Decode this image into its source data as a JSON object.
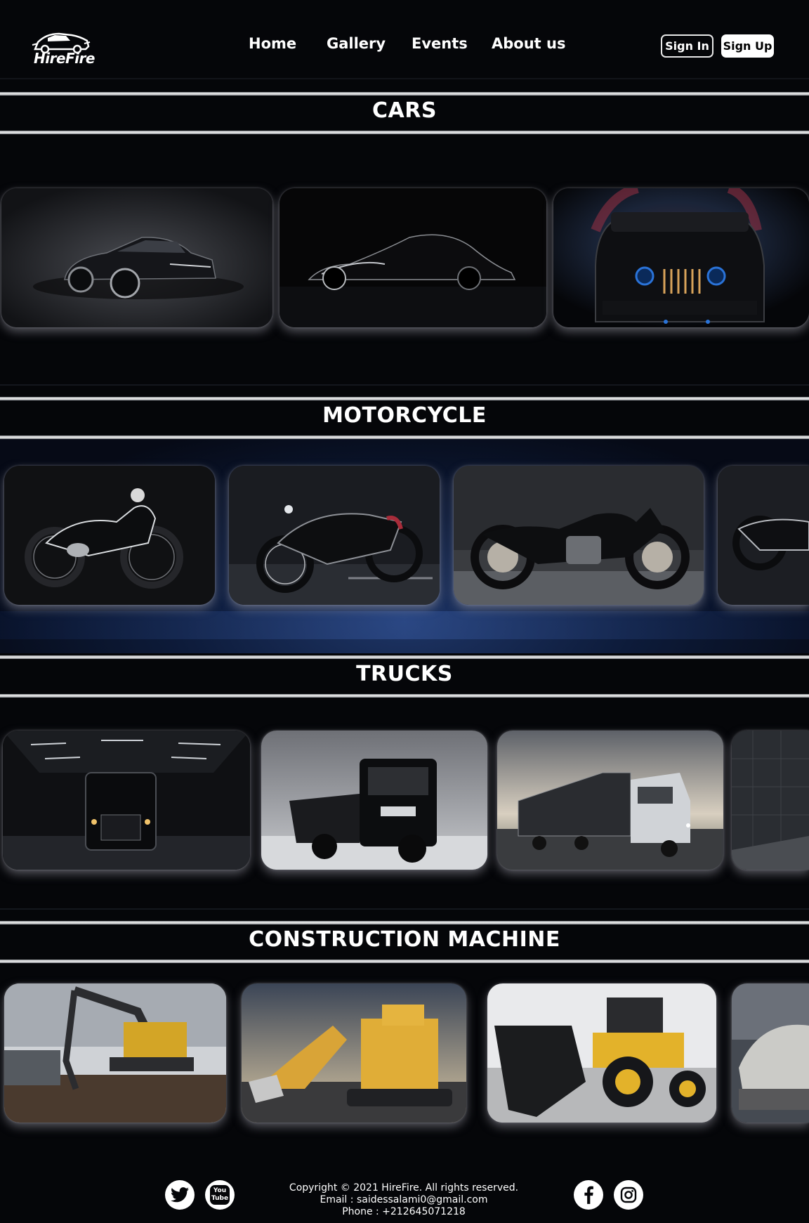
{
  "header": {
    "logo_text": "HireFire",
    "nav": [
      "Home",
      "Gallery",
      "Events",
      "About us"
    ],
    "sign_in": "Sign In",
    "sign_up": "Sign Up"
  },
  "sections": [
    {
      "title": "CARS",
      "cards": [
        "maserati-sedan",
        "vintage-coupe",
        "jeep-wrangler"
      ]
    },
    {
      "title": "MOTORCYCLE",
      "cards": [
        "vintage-bmw-motorcycle",
        "custom-chopper",
        "triumph-bobber",
        "cruiser-motorcycle"
      ]
    },
    {
      "title": "TRUCKS",
      "cards": [
        "mack-truck",
        "iveco-dump-truck",
        "iveco-road-train",
        "truck-in-tunnel"
      ]
    },
    {
      "title": "CONSTRUCTION MACHINE",
      "cards": [
        "volvo-excavator",
        "mining-shovel",
        "backhoe-loader",
        "bulldozer"
      ]
    }
  ],
  "footer": {
    "copyright": "Copyright © 2021 HireFire. All rights reserved.",
    "email": "Email : saidessalami0@gmail.com",
    "phone": "Phone : +212645071218",
    "youtube_label": "You Tube",
    "social_icons": [
      "twitter-icon",
      "youtube-icon",
      "facebook-icon",
      "instagram-icon"
    ]
  },
  "colors": {
    "background": "#050609",
    "band": "#e9eaec",
    "accent_blue": "#1e3566"
  }
}
